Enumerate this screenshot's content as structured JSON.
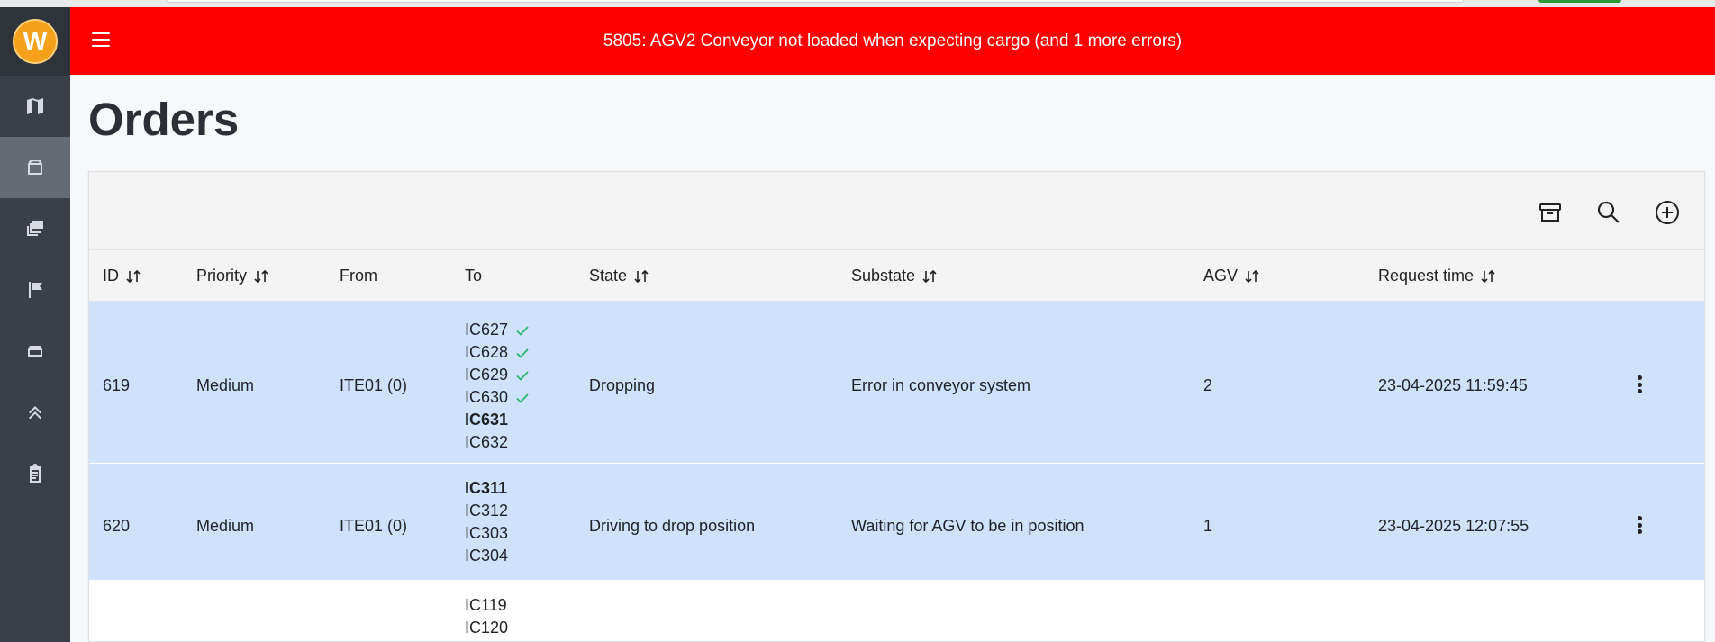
{
  "header": {
    "alert": "5805: AGV2 Conveyor not loaded when expecting cargo (and 1 more errors)"
  },
  "logo": {
    "letter": "W"
  },
  "sidebar": {
    "items": [
      {
        "name": "map-icon"
      },
      {
        "name": "box-icon",
        "active": true
      },
      {
        "name": "stack-icon"
      },
      {
        "name": "flag-icon"
      },
      {
        "name": "tray-icon"
      },
      {
        "name": "double-chevron-up-icon"
      },
      {
        "name": "clipboard-icon"
      }
    ]
  },
  "page": {
    "title": "Orders"
  },
  "toolbar": {
    "icons": [
      "archive-icon",
      "search-icon",
      "add-circle-icon"
    ]
  },
  "table": {
    "columns": {
      "id": "ID",
      "priority": "Priority",
      "from": "From",
      "to": "To",
      "state": "State",
      "substate": "Substate",
      "agv": "AGV",
      "request_time": "Request time"
    },
    "rows": [
      {
        "id": "619",
        "priority": "Medium",
        "from": "ITE01 (0)",
        "to": [
          {
            "label": "IC627",
            "done": true,
            "bold": false
          },
          {
            "label": "IC628",
            "done": true,
            "bold": false
          },
          {
            "label": "IC629",
            "done": true,
            "bold": false
          },
          {
            "label": "IC630",
            "done": true,
            "bold": false
          },
          {
            "label": "IC631",
            "done": false,
            "bold": true
          },
          {
            "label": "IC632",
            "done": false,
            "bold": false
          }
        ],
        "state": "Dropping",
        "substate": "Error in conveyor system",
        "agv": "2",
        "request_time": "23-04-2025 11:59:45"
      },
      {
        "id": "620",
        "priority": "Medium",
        "from": "ITE01 (0)",
        "to": [
          {
            "label": "IC311",
            "done": false,
            "bold": true
          },
          {
            "label": "IC312",
            "done": false,
            "bold": false
          },
          {
            "label": "IC303",
            "done": false,
            "bold": false
          },
          {
            "label": "IC304",
            "done": false,
            "bold": false
          }
        ],
        "state": "Driving to drop position",
        "substate": "Waiting for AGV to be in position",
        "agv": "1",
        "request_time": "23-04-2025 12:07:55"
      },
      {
        "to": [
          {
            "label": "IC119",
            "done": false,
            "bold": false
          },
          {
            "label": "IC120",
            "done": false,
            "bold": false
          }
        ]
      }
    ]
  },
  "colors": {
    "header_bg": "#ff0000",
    "sidebar_bg": "#3a3f48",
    "selected_row_bg": "#cfe2fb",
    "check": "#2bb673",
    "logo": "#f6a11b"
  }
}
